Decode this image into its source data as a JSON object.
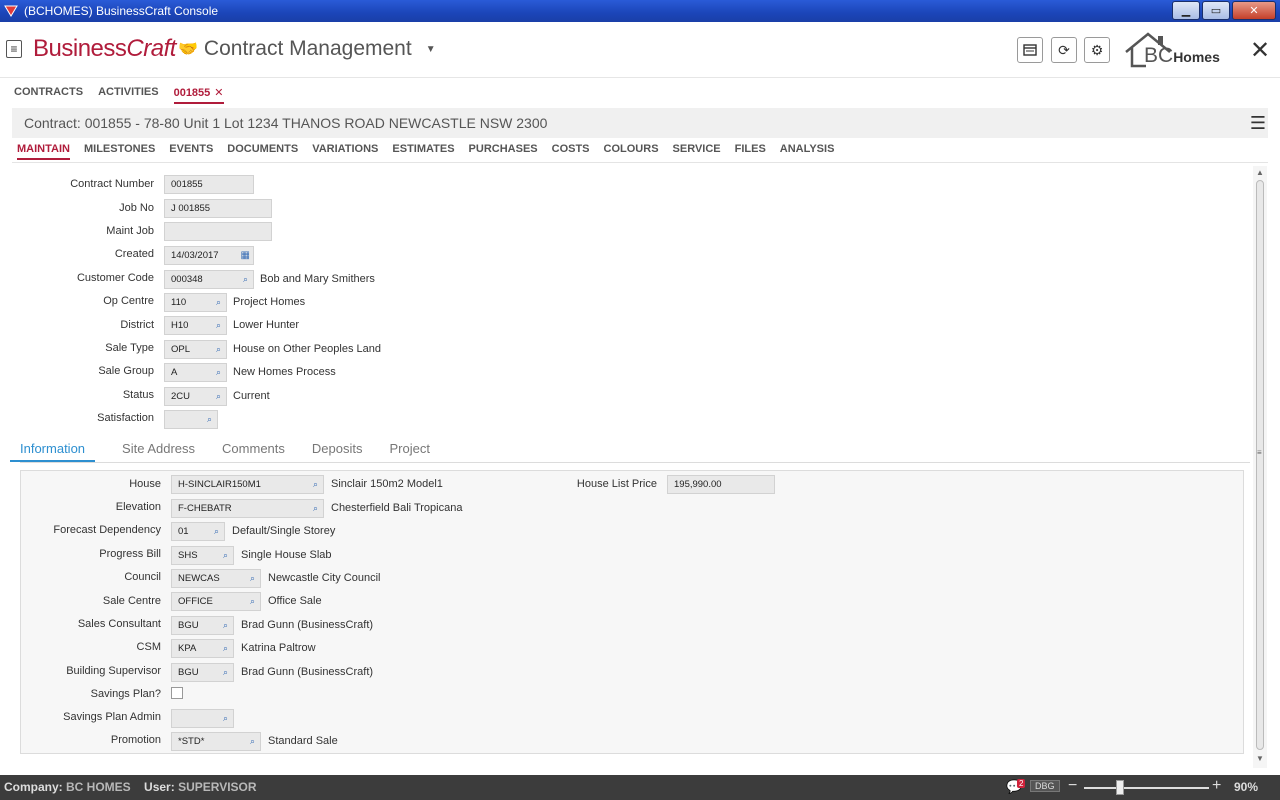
{
  "window": {
    "title": "(BCHOMES) BusinessCraft Console"
  },
  "header": {
    "brand": "BusinessCraft",
    "module": "Contract Management",
    "logo_text_bc": "BC",
    "logo_text_homes": "Homes"
  },
  "doc_tabs": {
    "contracts": "CONTRACTS",
    "activities": "ACTIVITIES",
    "current": "001855"
  },
  "contract_title": "Contract: 001855 - 78-80 Unit  1 Lot 1234 THANOS ROAD NEWCASTLE NSW 2300",
  "section_tabs": [
    "MAINTAIN",
    "MILESTONES",
    "EVENTS",
    "DOCUMENTS",
    "VARIATIONS",
    "ESTIMATES",
    "PURCHASES",
    "COSTS",
    "COLOURS",
    "SERVICE",
    "FILES",
    "ANALYSIS"
  ],
  "form": {
    "contract_number": {
      "label": "Contract Number",
      "value": "001855"
    },
    "job_no": {
      "label": "Job No",
      "value": "J 001855"
    },
    "maint_job": {
      "label": "Maint Job",
      "value": ""
    },
    "created": {
      "label": "Created",
      "value": "14/03/2017"
    },
    "customer_code": {
      "label": "Customer Code",
      "value": "000348",
      "desc": "Bob and Mary Smithers"
    },
    "op_centre": {
      "label": "Op Centre",
      "value": "110",
      "desc": "Project Homes"
    },
    "district": {
      "label": "District",
      "value": "H10",
      "desc": "Lower Hunter"
    },
    "sale_type": {
      "label": "Sale Type",
      "value": "OPL",
      "desc": "House on Other Peoples Land"
    },
    "sale_group": {
      "label": "Sale Group",
      "value": "A",
      "desc": "New Homes Process"
    },
    "status": {
      "label": "Status",
      "value": "2CU",
      "desc": "Current"
    },
    "satisfaction": {
      "label": "Satisfaction",
      "value": ""
    }
  },
  "info_tabs": [
    "Information",
    "Site Address",
    "Comments",
    "Deposits",
    "Project"
  ],
  "info": {
    "house": {
      "label": "House",
      "value": "H-SINCLAIR150M1",
      "desc": "Sinclair 150m2 Model1"
    },
    "house_list_price": {
      "label": "House List Price",
      "value": "195,990.00"
    },
    "elevation": {
      "label": "Elevation",
      "value": "F-CHEBATR",
      "desc": "Chesterfield Bali Tropicana"
    },
    "forecast_dependency": {
      "label": "Forecast Dependency",
      "value": "01",
      "desc": "Default/Single Storey"
    },
    "progress_bill": {
      "label": "Progress Bill",
      "value": "SHS",
      "desc": "Single House Slab"
    },
    "council": {
      "label": "Council",
      "value": "NEWCAS",
      "desc": "Newcastle City Council"
    },
    "sale_centre": {
      "label": "Sale Centre",
      "value": "OFFICE",
      "desc": "Office Sale"
    },
    "sales_consultant": {
      "label": "Sales Consultant",
      "value": "BGU",
      "desc": "Brad Gunn (BusinessCraft)"
    },
    "csm": {
      "label": "CSM",
      "value": "KPA",
      "desc": "Katrina Paltrow"
    },
    "building_supervisor": {
      "label": "Building Supervisor",
      "value": "BGU",
      "desc": "Brad Gunn (BusinessCraft)"
    },
    "savings_plan": {
      "label": "Savings Plan?",
      "checked": false
    },
    "savings_plan_admin": {
      "label": "Savings Plan Admin",
      "value": ""
    },
    "promotion": {
      "label": "Promotion",
      "value": "*STD*",
      "desc": "Standard Sale"
    }
  },
  "statusbar": {
    "company_label": "Company:",
    "company": "BC HOMES",
    "user_label": "User:",
    "user": "SUPERVISOR",
    "notifications": "2",
    "dbg": "DBG",
    "zoom": "90%"
  }
}
